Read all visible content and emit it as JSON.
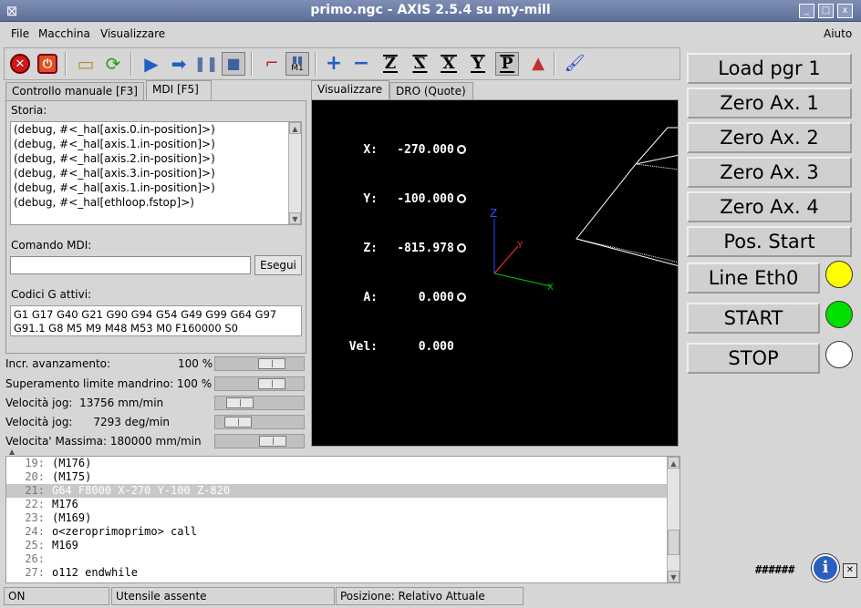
{
  "window": {
    "title": "primo.ngc - AXIS 2.5.4 su my-mill",
    "controls": [
      "_",
      "□",
      "x"
    ]
  },
  "menu": {
    "file": "File",
    "machine": "Macchina",
    "view": "Visualizzare",
    "help": "Aiuto"
  },
  "toolbar": {
    "icons": [
      "estop-icon",
      "power-icon",
      "open-icon",
      "reload-icon",
      "run-icon",
      "step-icon",
      "pause-icon",
      "stop-icon",
      "touchoff-icon",
      "tool-table-icon",
      "zoom-in-icon",
      "zoom-out-icon",
      "view-z-icon",
      "view-z2-icon",
      "view-x-icon",
      "view-y-icon",
      "view-p-icon",
      "rotate-icon",
      "clear-icon"
    ],
    "m1_label": "M1",
    "z_label": "Z",
    "x_label": "X",
    "y_label": "Y",
    "p_label": "P"
  },
  "left_tabs": {
    "manual": "Controllo manuale [F3]",
    "mdi": "MDI [F5]"
  },
  "mdi": {
    "history_label": "Storia:",
    "history": [
      "(debug, #<_hal[axis.0.in-position]>)",
      "(debug, #<_hal[axis.1.in-position]>)",
      "(debug, #<_hal[axis.2.in-position]>)",
      "(debug, #<_hal[axis.3.in-position]>)",
      "(debug, #<_hal[axis.1.in-position]>)",
      "(debug, #<_hal[ethloop.fstop]>)"
    ],
    "command_label": "Comando MDI:",
    "command_value": "",
    "execute_label": "Esegui",
    "gcodes_label": "Codici G attivi:",
    "gcodes_line1": "G1 G17 G40 G21 G90 G94 G54 G49 G99 G64 G97",
    "gcodes_line2": "G91.1 G8 M5 M9 M48 M53 M0 F160000 S0"
  },
  "sliders": [
    {
      "label": "Incr. avanzamento:",
      "value": "100 %",
      "fraction": 0.7
    },
    {
      "label": "Superamento limite mandrino:",
      "value": "100 %",
      "fraction": 0.7
    },
    {
      "label": "Velocità jog:",
      "value": "13756 mm/min",
      "fraction": 0.18
    },
    {
      "label": "Velocità jog:",
      "value": "7293 deg/min",
      "fraction": 0.15
    },
    {
      "label": "Velocita' Massima:",
      "value": "180000 mm/min",
      "fraction": 0.72
    }
  ],
  "view_tabs": {
    "preview": "Visualizzare",
    "dro": "DRO (Quote)"
  },
  "dro": [
    {
      "axis": "X:",
      "value": "-270.000",
      "homed": true
    },
    {
      "axis": "Y:",
      "value": "-100.000",
      "homed": true
    },
    {
      "axis": "Z:",
      "value": "-815.978",
      "homed": true
    },
    {
      "axis": "A:",
      "value": "0.000",
      "homed": true
    },
    {
      "axis": "Vel:",
      "value": "0.000",
      "homed": false
    }
  ],
  "viewport_axes": {
    "x": "X",
    "y": "Y",
    "z": "Z"
  },
  "colors": {
    "led_yellow": "#ffff00",
    "led_green": "#00e000",
    "led_white": "#ffffff",
    "axis_x": "#00cc00",
    "axis_y": "#ff3030",
    "axis_z": "#3050ff"
  },
  "right_buttons": {
    "load": "Load pgr 1",
    "zero1": "Zero Ax. 1",
    "zero2": "Zero Ax. 2",
    "zero3": "Zero Ax. 3",
    "zero4": "Zero Ax. 4",
    "pos_start": "Pos. Start",
    "line_eth": "Line Eth0",
    "start": "START",
    "stop": "STOP"
  },
  "program": [
    {
      "n": "19:",
      "text": "(M176)",
      "active": false
    },
    {
      "n": "20:",
      "text": "(M175)",
      "active": false
    },
    {
      "n": "21:",
      "text": "G64 F8000 X-270 Y-100 Z-820",
      "active": true
    },
    {
      "n": "22:",
      "text": "M176",
      "active": false
    },
    {
      "n": "23:",
      "text": "(M169)",
      "active": false
    },
    {
      "n": "24:",
      "text": "o<zeroprimoprimo> call",
      "active": false
    },
    {
      "n": "25:",
      "text": "M169",
      "active": false
    },
    {
      "n": "26:",
      "text": "",
      "active": false
    },
    {
      "n": "27:",
      "text": "o112 endwhile",
      "active": false
    }
  ],
  "hash_text": "######",
  "status": {
    "state": "ON",
    "tool": "Utensile assente",
    "position": "Posizione: Relativo Attuale"
  }
}
